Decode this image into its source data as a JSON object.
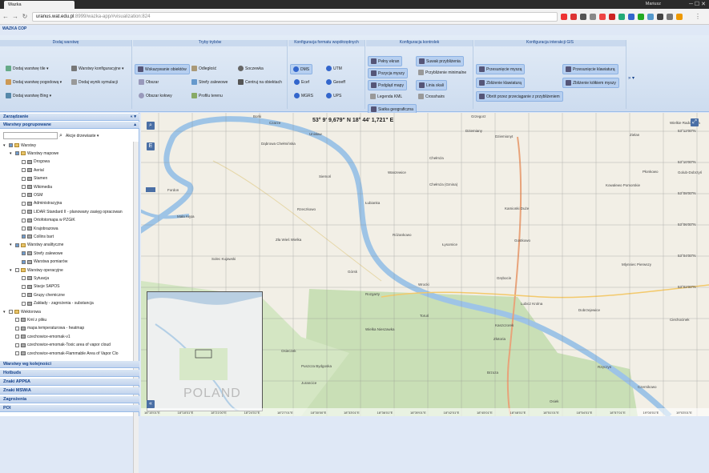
{
  "browser": {
    "tab_title": "Wazka",
    "user": "Mariusz",
    "url_host": "uranus.wat.edu.pl",
    "url_rest": ":8999/wazka-app/#visualization:824"
  },
  "app": {
    "title": "WAZKA COP"
  },
  "ribbon": {
    "groups": [
      {
        "title": "Dodaj warstwę",
        "items": [
          "Dodaj warstwę tile ▾",
          "Dodaj warstwę pogodową ▾",
          "Dodaj warstwę Bing ▾",
          "Warstwy konfiguracyjne ▾",
          "Dodaj wynik symulacji"
        ]
      },
      {
        "title": "Tryby trybów",
        "items": [
          "Wskazywanie obiektów",
          "Obszar",
          "Obszar kołowy",
          "Odległość",
          "Strefy zalewowe",
          "Profilu terenu",
          "Soczewka",
          "Centruj na obiektach"
        ]
      },
      {
        "title": "Konfiguracja formatu współrzędnych",
        "items": [
          "DMS",
          "Ecef",
          "MGRS",
          "UTM",
          "Geoeff",
          "UPS"
        ]
      },
      {
        "title": "Konfiguracja kontrolek",
        "items": [
          "Pełny ekran",
          "Pozycja myszy",
          "Podgląd mapy",
          "Legenda KML",
          "Siatka geograficzna",
          "Suwak przybliżenia",
          "Przybliżenie minimalne",
          "Linia skali",
          "Crosshairs"
        ]
      },
      {
        "title": "Konfiguracja interakcji GIS",
        "items": [
          "Przesunięcie myszą",
          "Zbliżenie klawiaturą",
          "Obrót przez przeciąganie z przybliżeniem",
          "Przesunięcie klawiaturą",
          "Zbliżenie kółkiem myszy"
        ]
      }
    ]
  },
  "sidebar": {
    "title": "Zarządzanie",
    "section": "Warstwy pogrupowane",
    "actions_label": "Akcje drzewiaste ▾",
    "tree": [
      {
        "label": "Warstwy",
        "level": 0,
        "checked": true,
        "kind": "folder"
      },
      {
        "label": "Warstwy mapowe",
        "level": 1,
        "checked": true,
        "kind": "folder"
      },
      {
        "label": "Drogowa",
        "level": 2,
        "checked": false,
        "kind": "layer"
      },
      {
        "label": "Aerial",
        "level": 2,
        "checked": false,
        "kind": "layer"
      },
      {
        "label": "Stamen",
        "level": 2,
        "checked": false,
        "kind": "layer"
      },
      {
        "label": "Wikimedia",
        "level": 2,
        "checked": false,
        "kind": "layer"
      },
      {
        "label": "OSM",
        "level": 2,
        "checked": false,
        "kind": "layer"
      },
      {
        "label": "Administracyjna",
        "level": 2,
        "checked": false,
        "kind": "layer"
      },
      {
        "label": "LIDAR Standard II - planowany zasięg opracowan",
        "level": 2,
        "checked": false,
        "kind": "layer"
      },
      {
        "label": "Ortofotomapa w PZGiK",
        "level": 2,
        "checked": false,
        "kind": "layer"
      },
      {
        "label": "Krajobrazowa",
        "level": 2,
        "checked": false,
        "kind": "layer"
      },
      {
        "label": "Collins bart",
        "level": 2,
        "checked": true,
        "kind": "layer"
      },
      {
        "label": "Warstwy analityczne",
        "level": 1,
        "checked": true,
        "kind": "folder"
      },
      {
        "label": "Strefy zalewowe",
        "level": 2,
        "checked": true,
        "kind": "layer"
      },
      {
        "label": "Warstwa pomiarów",
        "level": 2,
        "checked": true,
        "kind": "layer"
      },
      {
        "label": "Warstwy operacyjne",
        "level": 1,
        "checked": false,
        "kind": "folder"
      },
      {
        "label": "Sytuacja",
        "level": 2,
        "checked": false,
        "kind": "layer"
      },
      {
        "label": "Stacje SAPOS",
        "level": 2,
        "checked": false,
        "kind": "layer"
      },
      {
        "label": "Grupy chemiczne",
        "level": 2,
        "checked": false,
        "kind": "layer"
      },
      {
        "label": "Zakłady - zagrożenia - substancja",
        "level": 2,
        "checked": false,
        "kind": "layer"
      },
      {
        "label": "Wektorowa",
        "level": 0,
        "checked": false,
        "kind": "folder"
      },
      {
        "label": "Kml z pliku",
        "level": 1,
        "checked": false,
        "kind": "layer"
      },
      {
        "label": "mapa temperaturowa - heatmap",
        "level": 1,
        "checked": false,
        "kind": "layer"
      },
      {
        "label": "czechowice-emomak-v1",
        "level": 1,
        "checked": false,
        "kind": "layer"
      },
      {
        "label": "czechowice-emomak-Toxic area of vapor cloud",
        "level": 1,
        "checked": false,
        "kind": "layer"
      },
      {
        "label": "czechowice-emomak-Flammable Area of Vapor Clo",
        "level": 1,
        "checked": false,
        "kind": "layer"
      }
    ],
    "bottom_panels": [
      "Warstwy wg kolejności",
      "Hotbuds",
      "Znaki APP6A",
      "Znaki MSWiA",
      "Zagrożenia",
      "POI"
    ]
  },
  "map": {
    "coordinate_readout": "53° 9' 9,679\" N 18° 44' 1,721\" E",
    "places": [
      "Borki",
      "Czarze",
      "Unisław",
      "Grzegorz",
      "Dziemiany",
      "Dziemionyt",
      "Zielan",
      "Wielkie Radowiska",
      "Dąbrowa Chełmińska",
      "Siemoń",
      "Wanzewice",
      "Chełmża",
      "Chełmża (Gmina)",
      "Kowalewo Pomorskie",
      "Płonkowo",
      "Fordon",
      "Łubianka",
      "Kamionki Duże",
      "Golub-Dobrzyń",
      "Mała Kępa",
      "Rzeczkowo",
      "Zła Wieś Wielka",
      "Różankowo",
      "Łysomice",
      "Gostkowo",
      "Solec Kujawski",
      "Mlynniec Pierwszy",
      "Górsk",
      "Rozgarty",
      "Wrocki",
      "Grębocin",
      "Toruń",
      "Lubicz Krolna",
      "Dobrzejewice",
      "Wielka Nieszawka",
      "Kaszczorek",
      "Złotoria",
      "Ciechocinek",
      "Osieczek",
      "Jurancice",
      "Brzoza",
      "Rzęczyn",
      "Czernikowo",
      "Osiek",
      "Puszcza Bydgoska"
    ],
    "minimap_label": "POLAND",
    "axis_ticks": [
      "18°15'01\"E",
      "18°18'01\"E",
      "18°21'00\"E",
      "18°24'01\"E",
      "18°27'01\"E",
      "18°30'00\"E",
      "18°33'01\"E",
      "18°36'01\"E",
      "18°39'01\"E",
      "18°42'01\"E",
      "18°45'01\"E",
      "18°48'01\"E",
      "18°51'01\"E",
      "18°54'01\"E",
      "18°57'01\"E",
      "19°00'01\"E",
      "19°03'01\"E"
    ],
    "lat_ticks": [
      "53°12'00\"N",
      "53°10'00\"N",
      "53°08'00\"N",
      "53°06'00\"N",
      "53°04'00\"N",
      "53°02'00\"N"
    ]
  }
}
